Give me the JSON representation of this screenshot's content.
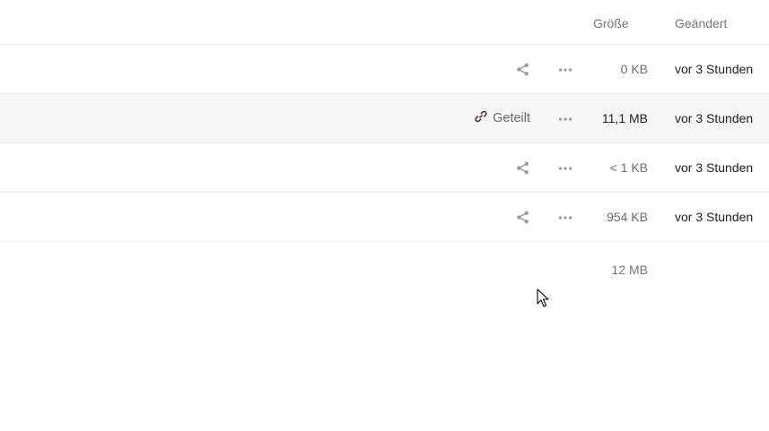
{
  "header": {
    "size_label": "Größe",
    "modified_label": "Geändert"
  },
  "rows": [
    {
      "share_state": "share-icon",
      "size": "0 KB",
      "modified": "vor 3 Stunden"
    },
    {
      "share_state": "link-icon",
      "shared_label": "Geteilt",
      "size": "11,1 MB",
      "modified": "vor 3 Stunden"
    },
    {
      "share_state": "share-icon",
      "size": "< 1 KB",
      "modified": "vor 3 Stunden"
    },
    {
      "share_state": "share-icon",
      "size": "954 KB",
      "modified": "vor 3 Stunden"
    }
  ],
  "summary": {
    "total_size": "12 MB"
  },
  "icons": {
    "share": "share-icon",
    "link": "link-icon",
    "more": "more-options-icon",
    "cursor": "mouse-cursor-icon"
  },
  "colors": {
    "row_highlight": "#f5f6f5",
    "divider": "#ededed",
    "icon_gray": "#9a9a9a",
    "link_icon": "#5a2a2a"
  }
}
